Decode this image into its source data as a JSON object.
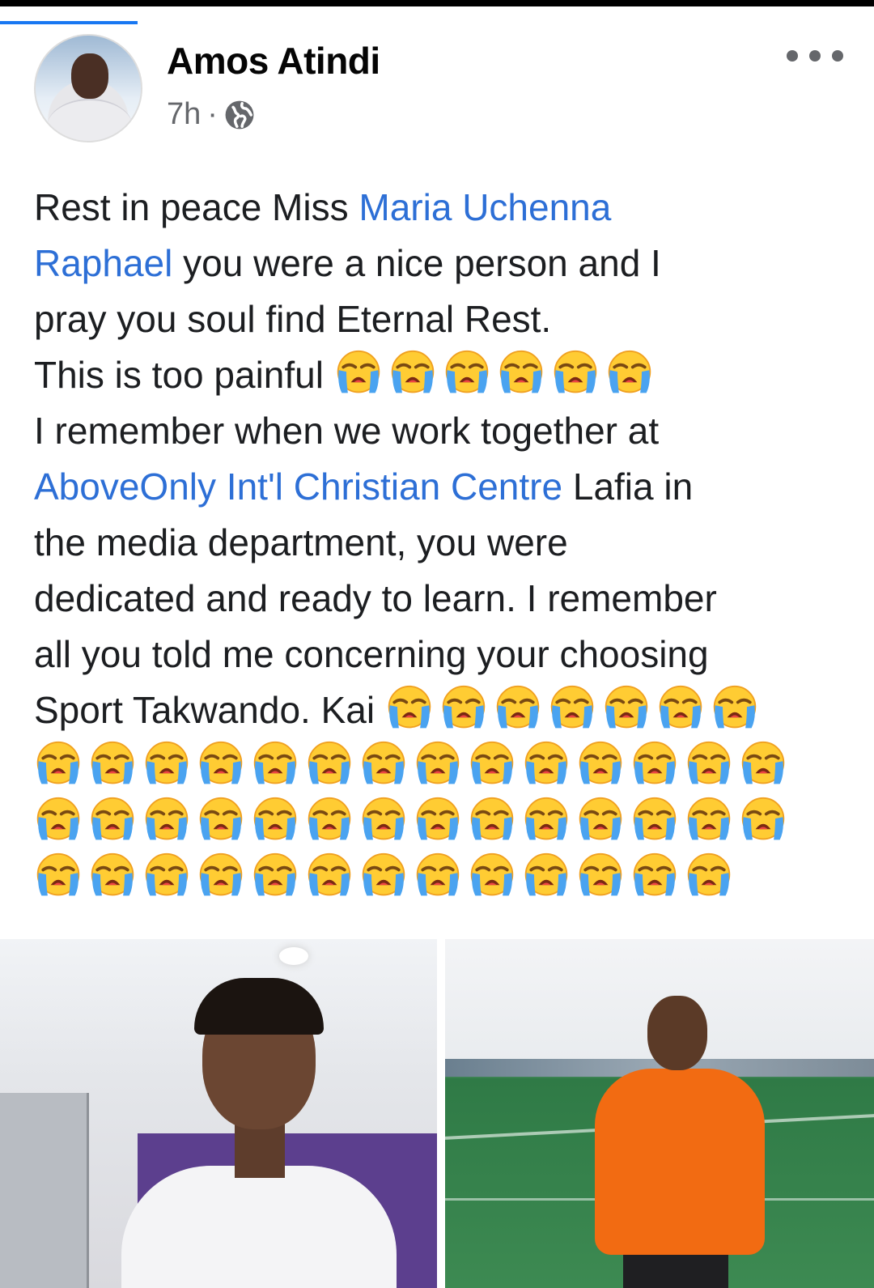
{
  "post": {
    "author": "Amos Atindi",
    "time": "7h",
    "separator": "·",
    "privacy_icon": "globe-icon",
    "more_icon": "more-options-icon"
  },
  "text": {
    "l1_a": "Rest in peace Miss ",
    "l1_link": "Maria Uchenna",
    "l2_link": "Raphael",
    "l2_b": " you were a nice person and I",
    "l3": "pray you soul find Eternal Rest.",
    "l4": "This is too painful ",
    "l5": "I remember when we work together at",
    "l6_link": "AboveOnly Int'l Christian Centre",
    "l6_b": " Lafia in",
    "l7": "the media department, you were",
    "l8": "dedicated and ready to learn. I remember",
    "l9": "all you told me concerning your choosing",
    "l10": "Sport Takwando. Kai "
  },
  "emoji": {
    "name": "loudly-crying-face-emoji",
    "line4_count": 6,
    "line10_count": 7,
    "line11_count": 14,
    "line12_count": 14,
    "line13_count": 13
  },
  "colors": {
    "link": "#2d6fd6",
    "text": "#1c1e21",
    "meta": "#65676b",
    "tab_indicator": "#1877f2"
  }
}
